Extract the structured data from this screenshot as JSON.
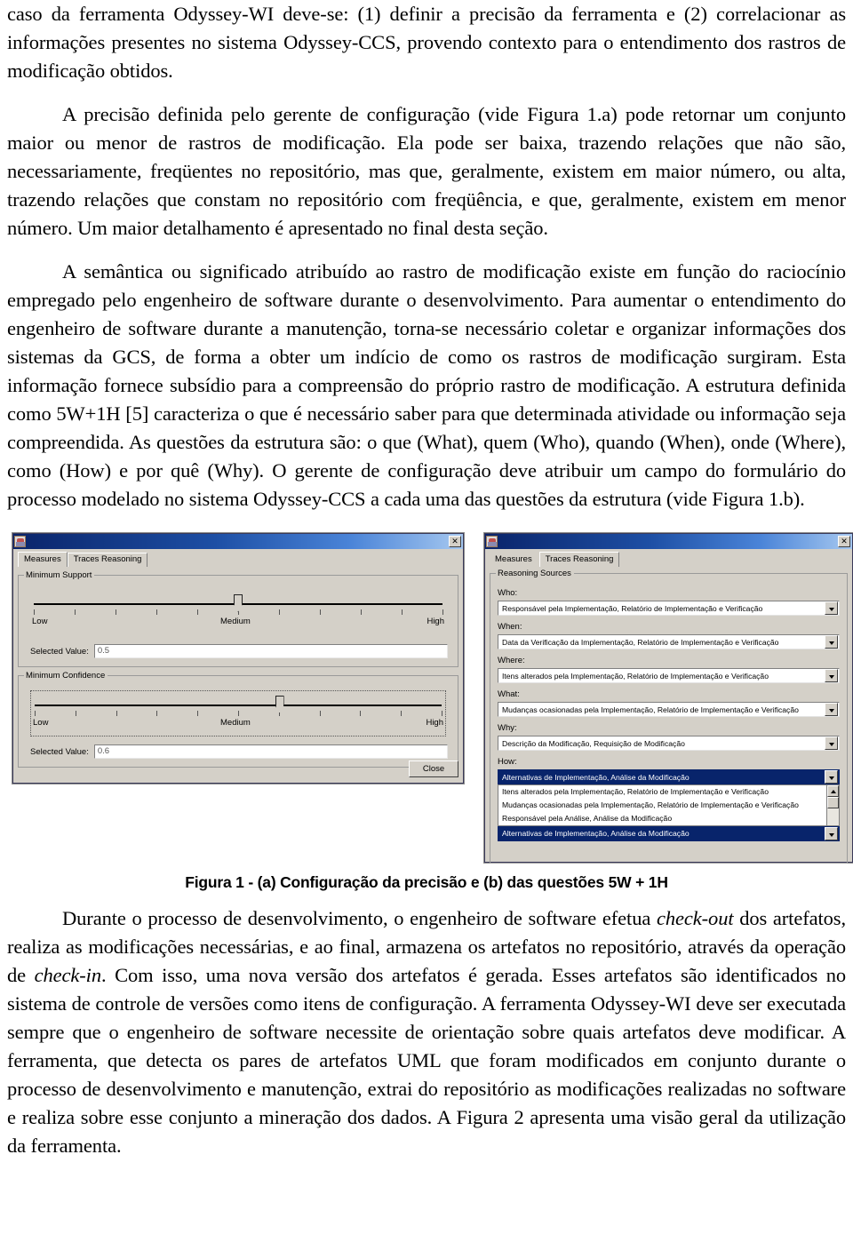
{
  "document": {
    "paragraphs": [
      {
        "id": "p1",
        "indent": false,
        "text": "caso da ferramenta Odyssey-WI deve-se: (1) definir a precisão da ferramenta e (2) correlacionar as informações presentes no sistema Odyssey-CCS, provendo contexto para o entendimento dos rastros de modificação obtidos."
      },
      {
        "id": "p2",
        "indent": true,
        "text": "A precisão definida pelo gerente de configuração (vide Figura 1.a) pode retornar um conjunto maior ou menor de rastros de modificação. Ela pode ser baixa, trazendo relações que não são, necessariamente, freqüentes no repositório, mas que, geralmente, existem em maior número, ou alta, trazendo relações que constam no repositório com freqüência, e que, geralmente, existem em menor número. Um maior detalhamento é apresentado no final desta seção."
      },
      {
        "id": "p3",
        "indent": true,
        "text": "A semântica ou significado atribuído ao rastro de modificação existe em função do raciocínio empregado pelo engenheiro de software durante o desenvolvimento. Para aumentar o entendimento do engenheiro de software durante a manutenção, torna-se necessário coletar e organizar informações dos sistemas da GCS, de forma a obter um indício de como os rastros de modificação surgiram. Esta informação fornece subsídio para a compreensão do próprio rastro de modificação. A estrutura definida como 5W+1H [5] caracteriza o que é necessário saber para que determinada atividade ou informação seja compreendida. As questões da estrutura são: o que (What), quem (Who), quando (When), onde (Where), como (How) e por quê (Why). O gerente de configuração deve atribuir um campo do formulário do processo modelado no sistema Odyssey-CCS a cada uma das questões da estrutura (vide Figura 1.b)."
      }
    ],
    "figure_caption": "Figura 1 - (a) Configuração da precisão e (b) das questões 5W + 1H",
    "final_paragraph": {
      "id": "p4",
      "indent": true,
      "text": "Durante o processo de desenvolvimento, o engenheiro de software efetua check-out dos artefatos, realiza as modificações necessárias, e ao final, armazena os artefatos no repositório, através da operação de check-in. Com isso, uma nova versão dos artefatos é gerada. Esses artefatos são identificados no sistema de controle de versões como itens de configuração. A ferramenta Odyssey-WI deve ser executada sempre que o engenheiro de software necessite de orientação sobre quais artefatos deve modificar. A ferramenta, que detecta os pares de artefatos UML que foram modificados em conjunto durante o processo de desenvolvimento e manutenção, extrai do repositório as modificações realizadas no software e realiza sobre esse conjunto a mineração dos dados. A Figura 2 apresenta uma visão geral da utilização da ferramenta."
    }
  },
  "dialog_a": {
    "window_icon": "app-icon",
    "close_glyph": "✕",
    "tabs": [
      {
        "label": "Measures",
        "selected": true
      },
      {
        "label": "Traces Reasoning",
        "selected": false
      }
    ],
    "groups": [
      {
        "legend": "Minimum Support",
        "slider": {
          "low_label": "Low",
          "mid_label": "Medium",
          "high_label": "High",
          "tick_count": 11,
          "knob_percent": 50,
          "focused": false
        },
        "value_label": "Selected Value:",
        "value": "0.5"
      },
      {
        "legend": "Minimum Confidence",
        "slider": {
          "low_label": "Low",
          "mid_label": "Medium",
          "high_label": "High",
          "tick_count": 11,
          "knob_percent": 60,
          "focused": true
        },
        "value_label": "Selected Value:",
        "value": "0.6"
      }
    ],
    "close_button": "Close"
  },
  "dialog_b": {
    "window_icon": "app-icon",
    "close_glyph": "✕",
    "tabs": [
      {
        "label": "Measures",
        "selected": false
      },
      {
        "label": "Traces Reasoning",
        "selected": true
      }
    ],
    "group_legend": "Reasoning Sources",
    "fields": [
      {
        "label": "Who:",
        "value": "Responsável pela Implementação, Relatório de Implementação e Verificação"
      },
      {
        "label": "When:",
        "value": "Data da Verificação da Implementação, Relatório de Implementação e Verificação"
      },
      {
        "label": "Where:",
        "value": "Itens alterados pela Implementação, Relatório de Implementação e Verificação"
      },
      {
        "label": "What:",
        "value": "Mudanças ocasionadas pela Implementação, Relatório de Implementação e Verificação"
      },
      {
        "label": "Why:",
        "value": "Descrição da Modificação, Requisição de Modificação"
      }
    ],
    "open_field": {
      "label": "How:",
      "value": "Alternativas de Implementação, Análise da Modificação",
      "options": [
        {
          "text": "Itens alterados pela Implementação, Relatório de Implementação e Verificação",
          "highlighted": false
        },
        {
          "text": "Mudanças ocasionadas pela Implementação, Relatório de Implementação e Verificação",
          "highlighted": false
        },
        {
          "text": "Responsável pela Análise, Análise da Modificação",
          "highlighted": false
        },
        {
          "text": "Alternativas de Implementação, Análise da Modificação",
          "highlighted": true
        }
      ]
    }
  },
  "colors": {
    "titlebar_start": "#0a246a",
    "titlebar_end": "#a6c8f0",
    "dialog_face": "#d4d0c8",
    "selection": "#08246b",
    "field_bg": "#ffffff"
  }
}
